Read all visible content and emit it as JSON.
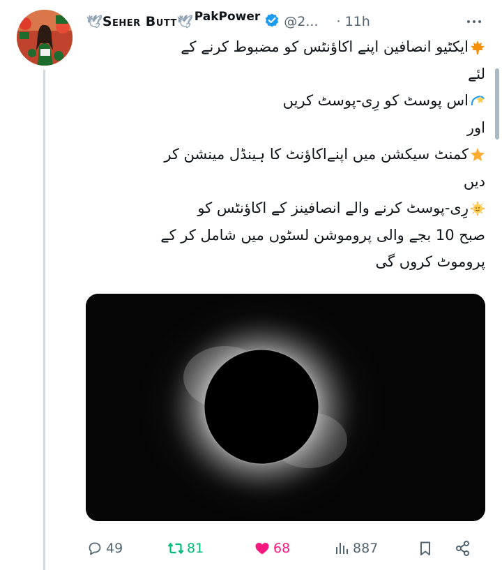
{
  "tweet": {
    "author": {
      "display_name_prefix": "🕊",
      "display_name": "Seher Butt",
      "display_name_suffix": "🕊",
      "name_tag": "PakPower",
      "handle": "@2...",
      "verified": true
    },
    "separator": "·",
    "time": "11h",
    "text_lines": [
      {
        "emoji": "maple-leaf",
        "text": "ایکٹیو انصافین اپنے اکاؤنٹس کو مضبوط کرنے کے"
      },
      {
        "emoji": null,
        "text": "لئے"
      },
      {
        "emoji": "dizzy",
        "text": "اس پوسٹ کو رِی-پوسٹ کریں"
      },
      {
        "emoji": null,
        "text": "اور"
      },
      {
        "emoji": "glowing-star",
        "text": "کمنٹ سیکشن میں اپنےاکاؤنٹ کا ہینڈل مینشن کر"
      },
      {
        "emoji": null,
        "text": "دیں"
      },
      {
        "emoji": "sun-face",
        "text": "رِی-پوسٹ کرنے والے انصافینز کے اکاؤنٹس کو"
      },
      {
        "emoji": null,
        "text": "صبح 10 بجے والی پروموشن لسٹوں میں شامل کر کے"
      },
      {
        "emoji": null,
        "text": "پروموٹ کروں گی"
      }
    ],
    "media": {
      "type": "image",
      "subject": "solar-eclipse"
    },
    "actions": {
      "replies": "49",
      "reposts": "81",
      "likes": "68",
      "views": "887"
    },
    "colors": {
      "text": "#0f1419",
      "muted": "#536471",
      "verified": "#1d9bf0",
      "repost": "#00ba7c",
      "like": "#f91880",
      "thread_line": "#cfd9de"
    },
    "icons": [
      "reply-icon",
      "repost-icon",
      "like-icon",
      "views-icon",
      "bookmark-icon",
      "share-icon",
      "verified-badge-icon",
      "more-icon"
    ]
  }
}
